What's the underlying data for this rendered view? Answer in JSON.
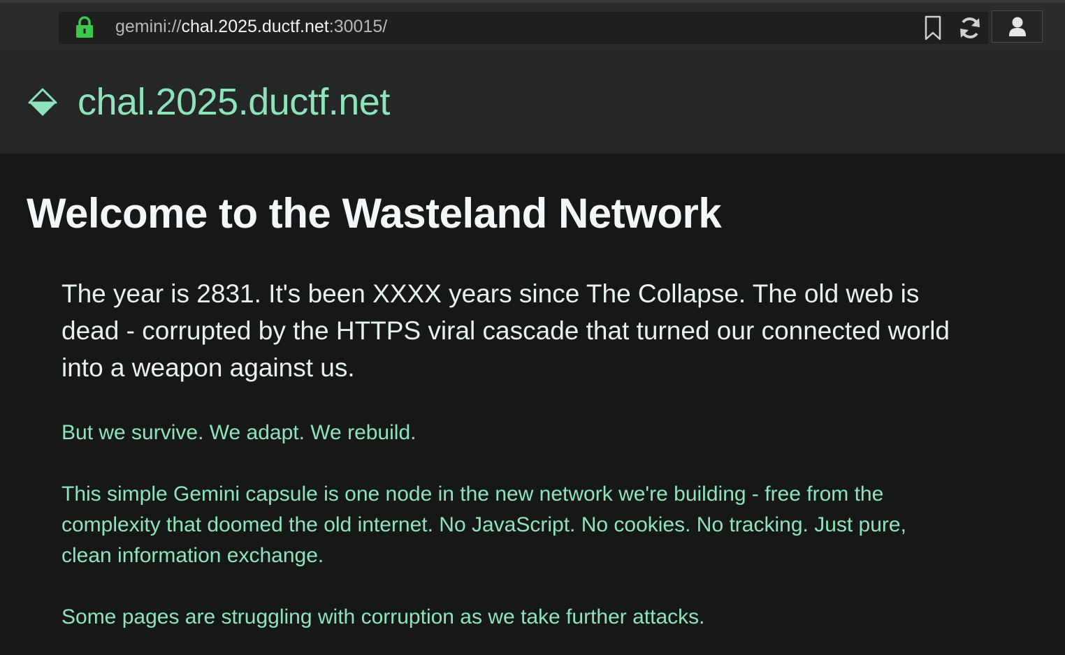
{
  "browser": {
    "url_scheme": "gemini://",
    "url_host": "chal.2025.ductf.net",
    "url_port_path": ":30015/",
    "icons": {
      "lock": "lock-icon",
      "bookmark": "bookmark-icon",
      "reload": "reload-icon",
      "identity": "user-icon"
    },
    "lock_color": "#3cc84a"
  },
  "site": {
    "title": "chal.2025.ductf.net",
    "icon": "diamond-icon",
    "accent_color": "#8fe3bb"
  },
  "page": {
    "heading": "Welcome to the Wasteland Network",
    "lead": "The year is 2831. It's been XXXX years since The Collapse. The old web is dead - corrupted by the HTTPS viral cascade that turned our connected world into a weapon against us.",
    "paragraphs": [
      "But we survive. We adapt. We rebuild.",
      "This simple Gemini capsule is one node in the new network we're building - free from the complexity that doomed the old internet. No JavaScript. No cookies. No tracking. Just pure, clean information exchange.",
      "Some pages are struggling with corruption as we take further attacks."
    ]
  }
}
